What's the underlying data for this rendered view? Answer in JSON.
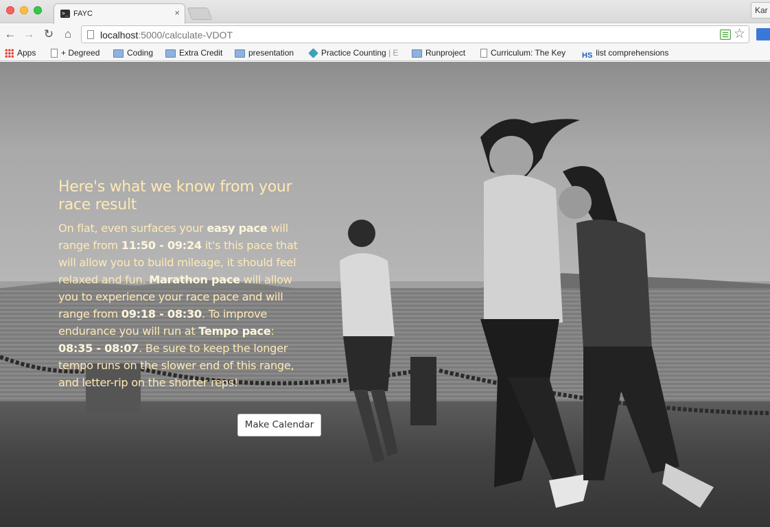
{
  "browser": {
    "tab_title": "FAYC",
    "tab_close": "×",
    "profile_label": "Kar",
    "url_host": "localhost",
    "url_rest": ":5000/calculate-VDOT",
    "nav": {
      "back": "←",
      "forward": "→",
      "reload": "↻",
      "home": "⌂"
    },
    "star": "☆"
  },
  "bookmarks": [
    {
      "label": "Apps",
      "icon": "apps-icon"
    },
    {
      "label": "+ Degreed",
      "icon": "page-icon"
    },
    {
      "label": "Coding",
      "icon": "folder-icon"
    },
    {
      "label": "Extra Credit",
      "icon": "folder-icon"
    },
    {
      "label": "presentation",
      "icon": "folder-icon"
    },
    {
      "label": "Practice Counting",
      "suffix": "| E",
      "icon": "gem-icon"
    },
    {
      "label": "Runproject",
      "icon": "folder-icon"
    },
    {
      "label": "Curriculum: The Key",
      "icon": "page-icon"
    },
    {
      "label": "list comprehensions",
      "prefix": "HS",
      "icon": "hs-icon"
    }
  ],
  "content": {
    "heading": "Here's what we know from your race result",
    "p1": "On flat, even surfaces your ",
    "easy_label": "easy pace",
    "p2": " will range from ",
    "easy_range": "11:50 - 09:24",
    "p3": " it's this pace that will allow you to build mileage, it should feel relaxed and fun. ",
    "marathon_label": "Marathon pace",
    "p4": " will allow you to experience your race pace and will range from ",
    "marathon_range": "09:18 - 08:30",
    "p5": ". To improve endurance you will run at ",
    "tempo_label": "Tempo pace",
    "p6": ": ",
    "tempo_range": "08:35 - 08:07",
    "p7": ". Be sure to keep the longer tempo runs on the slower end of this range, and letter-rip on the shorter reps!",
    "button_label": "Make Calendar"
  },
  "colors": {
    "text": "#ffe9b5",
    "button_bg": "#ffffff"
  }
}
